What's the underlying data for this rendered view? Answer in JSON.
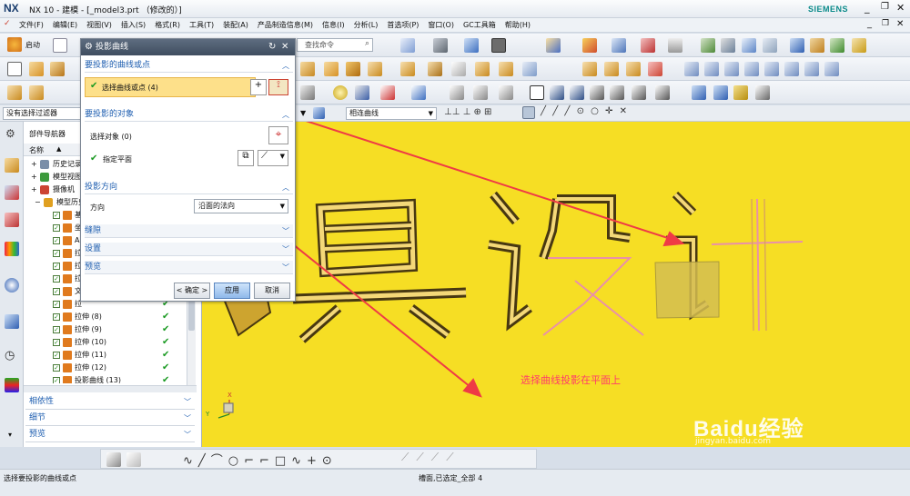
{
  "window": {
    "logo": "NX",
    "title": "NX 10 - 建模 - [_model3.prt （修改的）]",
    "brand": "SIEMENS"
  },
  "menu": [
    "文件(F)",
    "编辑(E)",
    "视图(V)",
    "插入(S)",
    "格式(R)",
    "工具(T)",
    "装配(A)",
    "产品制造信息(M)",
    "信息(I)",
    "分析(L)",
    "首选项(P)",
    "窗口(O)",
    "GC工具箱",
    "帮助(H)"
  ],
  "toolbar": {
    "start_label": "启动",
    "search_placeholder": "查找命令"
  },
  "filterbar": {
    "filter_value": "没有选择过滤器",
    "curve_rule": "相连曲线"
  },
  "navigator": {
    "title": "部件导航器",
    "column_name": "名称",
    "rows": [
      {
        "label": "历史记录",
        "check": false
      },
      {
        "label": "模型视图",
        "check": false
      },
      {
        "label": "摄像机",
        "check": false
      },
      {
        "label": "模型历史",
        "check": false
      },
      {
        "label": "基",
        "check": true
      },
      {
        "label": "坐",
        "check": true
      },
      {
        "label": "A",
        "check": true
      },
      {
        "label": "拉",
        "check": true
      },
      {
        "label": "拉",
        "check": true
      },
      {
        "label": "拉",
        "check": true
      },
      {
        "label": "文",
        "check": true
      },
      {
        "label": "拉",
        "check": true
      },
      {
        "label": "拉伸 (8)",
        "check": true
      },
      {
        "label": "拉伸 (9)",
        "check": true
      },
      {
        "label": "拉伸 (10)",
        "check": true
      },
      {
        "label": "拉伸 (11)",
        "check": true
      },
      {
        "label": "拉伸 (12)",
        "check": true
      },
      {
        "label": "投影曲线 (13)",
        "check": true
      }
    ],
    "sections": [
      "相依性",
      "细节",
      "预览"
    ]
  },
  "dialog": {
    "title": "投影曲线",
    "section_curves": "要投影的曲线或点",
    "select_curves": "选择曲线或点 (4)",
    "section_objects": "要投影的对象",
    "select_object": "选择对象 (0)",
    "specify_plane": "指定平面",
    "section_direction": "投影方向",
    "direction_label": "方向",
    "direction_value": "沿面的法向",
    "section_gap": "缝隙",
    "section_settings": "设置",
    "section_preview": "预览",
    "ok": "< 确定 >",
    "apply": "应用",
    "cancel": "取消"
  },
  "viewport": {
    "model_text": "模具设计",
    "annotation": "选择曲线投影在平面上",
    "background": "#f6de24",
    "annotation_color": "#ff3b6b",
    "arrow_color": "#ef3b45"
  },
  "status": {
    "prompt": "选择要投影的曲线或点",
    "selection": "槽面,已选定_全部 4"
  },
  "watermark": {
    "brand": "Baidu经验",
    "url": "jingyan.baidu.com"
  }
}
